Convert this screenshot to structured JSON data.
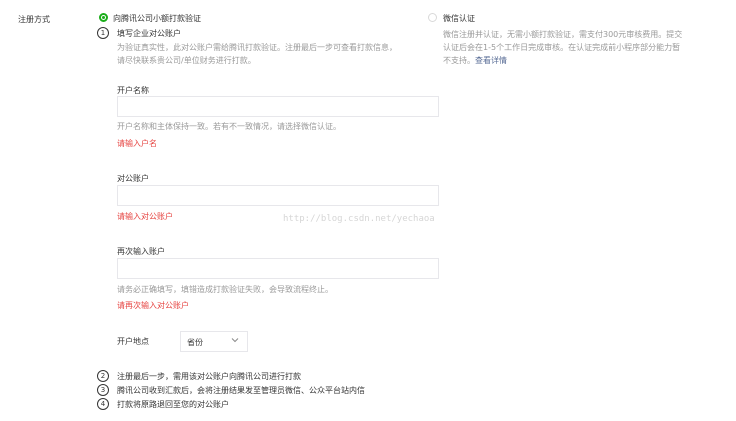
{
  "row_label": "注册方式",
  "option_tencent": {
    "label": "向腾讯公司小额打款验证",
    "selected": true
  },
  "option_wechat": {
    "label": "微信认证",
    "desc_line1": "微信注册并认证，无需小额打款验证，需支付300元审核费用。提交",
    "desc_line2": "认证后会在1-5个工作日完成审核。在认证完成前小程序部分能力暂",
    "desc_line3_prefix": "不支持。",
    "details_link": "查看详情"
  },
  "step1": {
    "number": "1",
    "title": "填写企业对公账户",
    "desc_line1": "为验证真实性，此对公账户需给腾讯打款验证。注册最后一步可查看打款信息，",
    "desc_line2": "请尽快联系贵公司/单位财务进行打款。"
  },
  "account_name": {
    "label": "开户名称",
    "value": "",
    "hint": "开户名称和主体保持一致。若有不一致情况，请选择微信认证。",
    "error": "请输入户名"
  },
  "account_number": {
    "label": "对公账户",
    "value": "",
    "error": "请输入对公账户"
  },
  "account_number_confirm": {
    "label": "再次输入账户",
    "value": "",
    "hint": "请务必正确填写，填错造成打款验证失败，会导致流程终止。",
    "error": "请再次输入对公账户"
  },
  "bank_location": {
    "label": "开户地点",
    "selected": "省份"
  },
  "steps_after": [
    {
      "number": "2",
      "text": "注册最后一步，需用该对公账户向腾讯公司进行打款"
    },
    {
      "number": "3",
      "text": "腾讯公司收到汇款后，会将注册结果发至管理员微信、公众平台站内信"
    },
    {
      "number": "4",
      "text": "打款将原路退回至您的对公账户"
    }
  ],
  "watermark": "http://blog.csdn.net/yechaoa",
  "colors": {
    "accent_green": "#1aad19",
    "error_red": "#e64340",
    "link_blue": "#576b95",
    "hint_gray": "#9a9a9a"
  }
}
